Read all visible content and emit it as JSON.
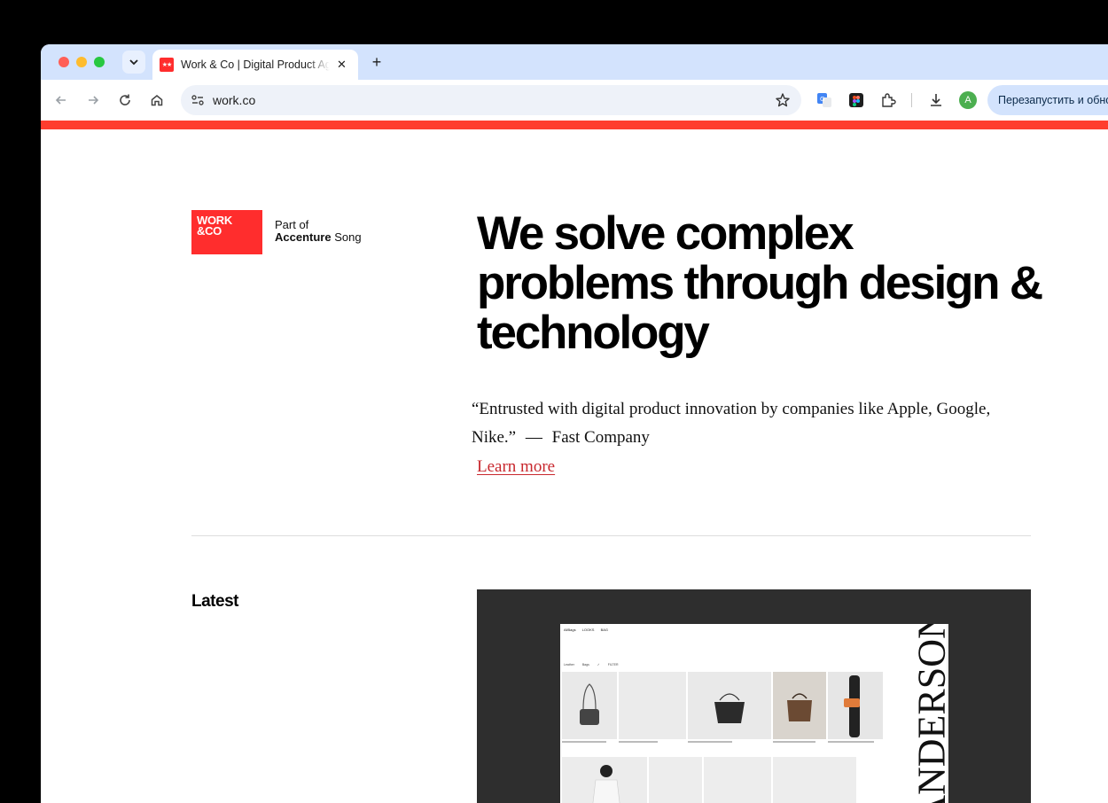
{
  "browser": {
    "tab_title": "Work & Co | Digital Product Agency",
    "favicon_glyph": "★★",
    "new_tab_glyph": "+",
    "close_glyph": "✕",
    "url": "work.co",
    "profile_initial": "A",
    "relaunch_label": "Перезапустить и обновить",
    "icons": [
      "tab-search-icon",
      "back-icon",
      "forward-icon",
      "reload-icon",
      "home-icon",
      "site-settings-icon",
      "bookmark-star-icon",
      "translate-extension-icon",
      "figma-extension-icon",
      "extensions-puzzle-icon",
      "download-icon"
    ]
  },
  "page": {
    "accent": "#ff3d2e",
    "logo": {
      "line1": "WORK",
      "line2": "&CO",
      "part_of": "Part of",
      "parent_bold": "Accenture",
      "parent_rest": " Song"
    },
    "headline": "We solve complex problems through design & technology",
    "quote": "“Entrusted with digital product innovation by companies like Apple, Google, Nike.”",
    "quote_dash": "—",
    "quote_source": "Fast Company",
    "learn_more": "Learn more",
    "latest_heading": "Latest",
    "feature": {
      "nav": "AllBags LOOKS BAG",
      "filter": "Leather Bags ✓ FILTER",
      "brand_word": "ANDERSON"
    }
  }
}
